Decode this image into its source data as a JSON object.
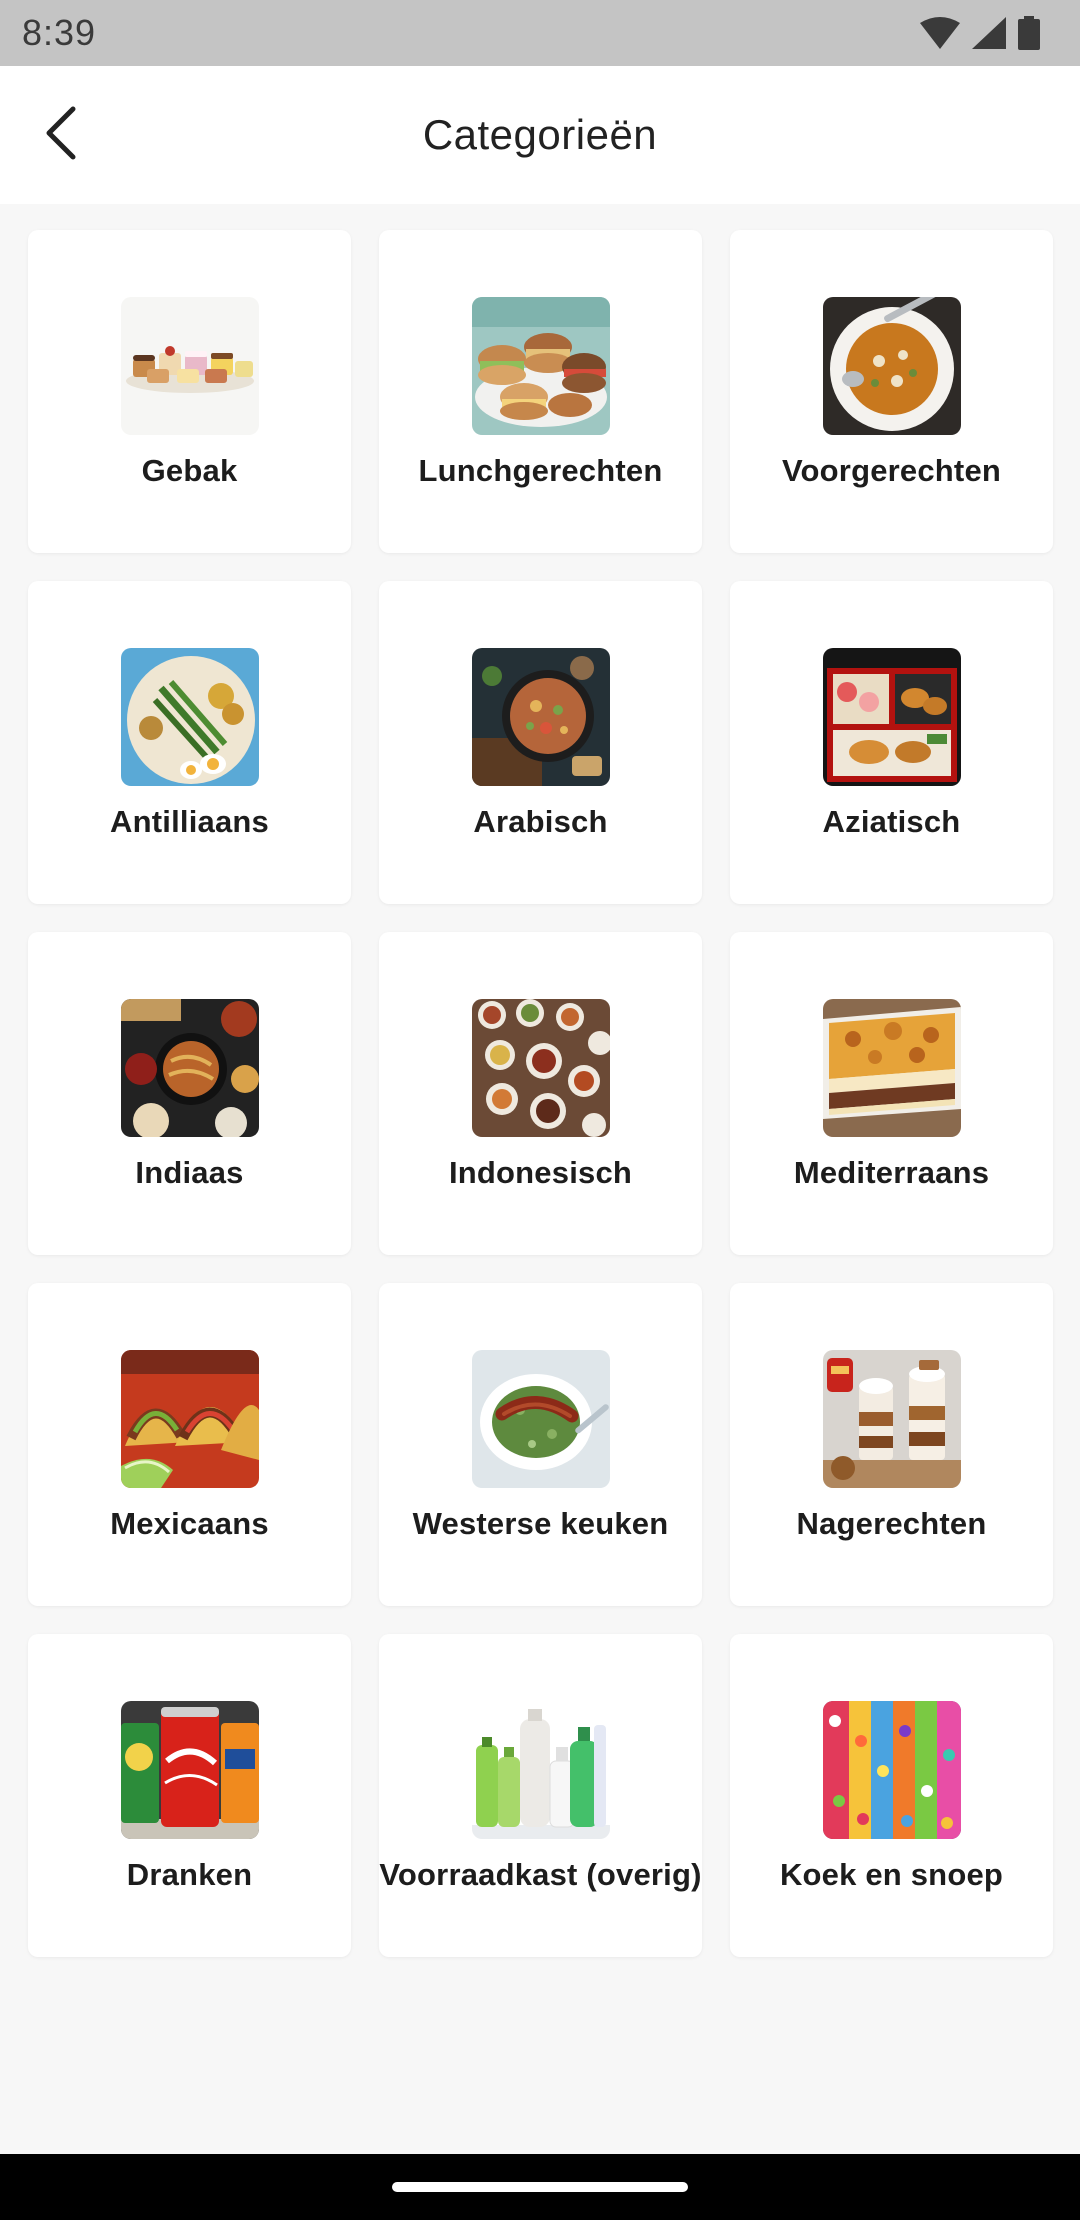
{
  "status_bar": {
    "time": "8:39",
    "icons": [
      "wifi-icon",
      "cellular-signal-icon",
      "battery-icon"
    ]
  },
  "app_bar": {
    "back_icon": "arrow-back-icon",
    "title": "Categorieën"
  },
  "categories": [
    {
      "label": "Gebak",
      "icon": "pastry-photo"
    },
    {
      "label": "Lunchgerechten",
      "icon": "lunch-sandwiches-photo"
    },
    {
      "label": "Voorgerechten",
      "icon": "soup-photo"
    },
    {
      "label": "Antilliaans",
      "icon": "antillean-dish-photo"
    },
    {
      "label": "Arabisch",
      "icon": "arabic-dish-photo"
    },
    {
      "label": "Aziatisch",
      "icon": "asian-bento-photo"
    },
    {
      "label": "Indiaas",
      "icon": "indian-dishes-photo"
    },
    {
      "label": "Indonesisch",
      "icon": "indonesian-rijsttafel-photo"
    },
    {
      "label": "Mediterraans",
      "icon": "moussaka-photo"
    },
    {
      "label": "Mexicaans",
      "icon": "tacos-photo"
    },
    {
      "label": "Westerse keuken",
      "icon": "stamppot-sausage-photo"
    },
    {
      "label": "Nagerechten",
      "icon": "dessert-glasses-photo"
    },
    {
      "label": "Dranken",
      "icon": "soda-cans-photo"
    },
    {
      "label": "Voorraadkast (overig)",
      "icon": "pantry-bottles-photo"
    },
    {
      "label": "Koek en snoep",
      "icon": "candy-photo"
    }
  ],
  "colors": {
    "status_bar": "#c4c4c4",
    "app_bar": "#ffffff",
    "background": "#f7f7f7",
    "card": "#ffffff",
    "nav_bar": "#000000"
  }
}
